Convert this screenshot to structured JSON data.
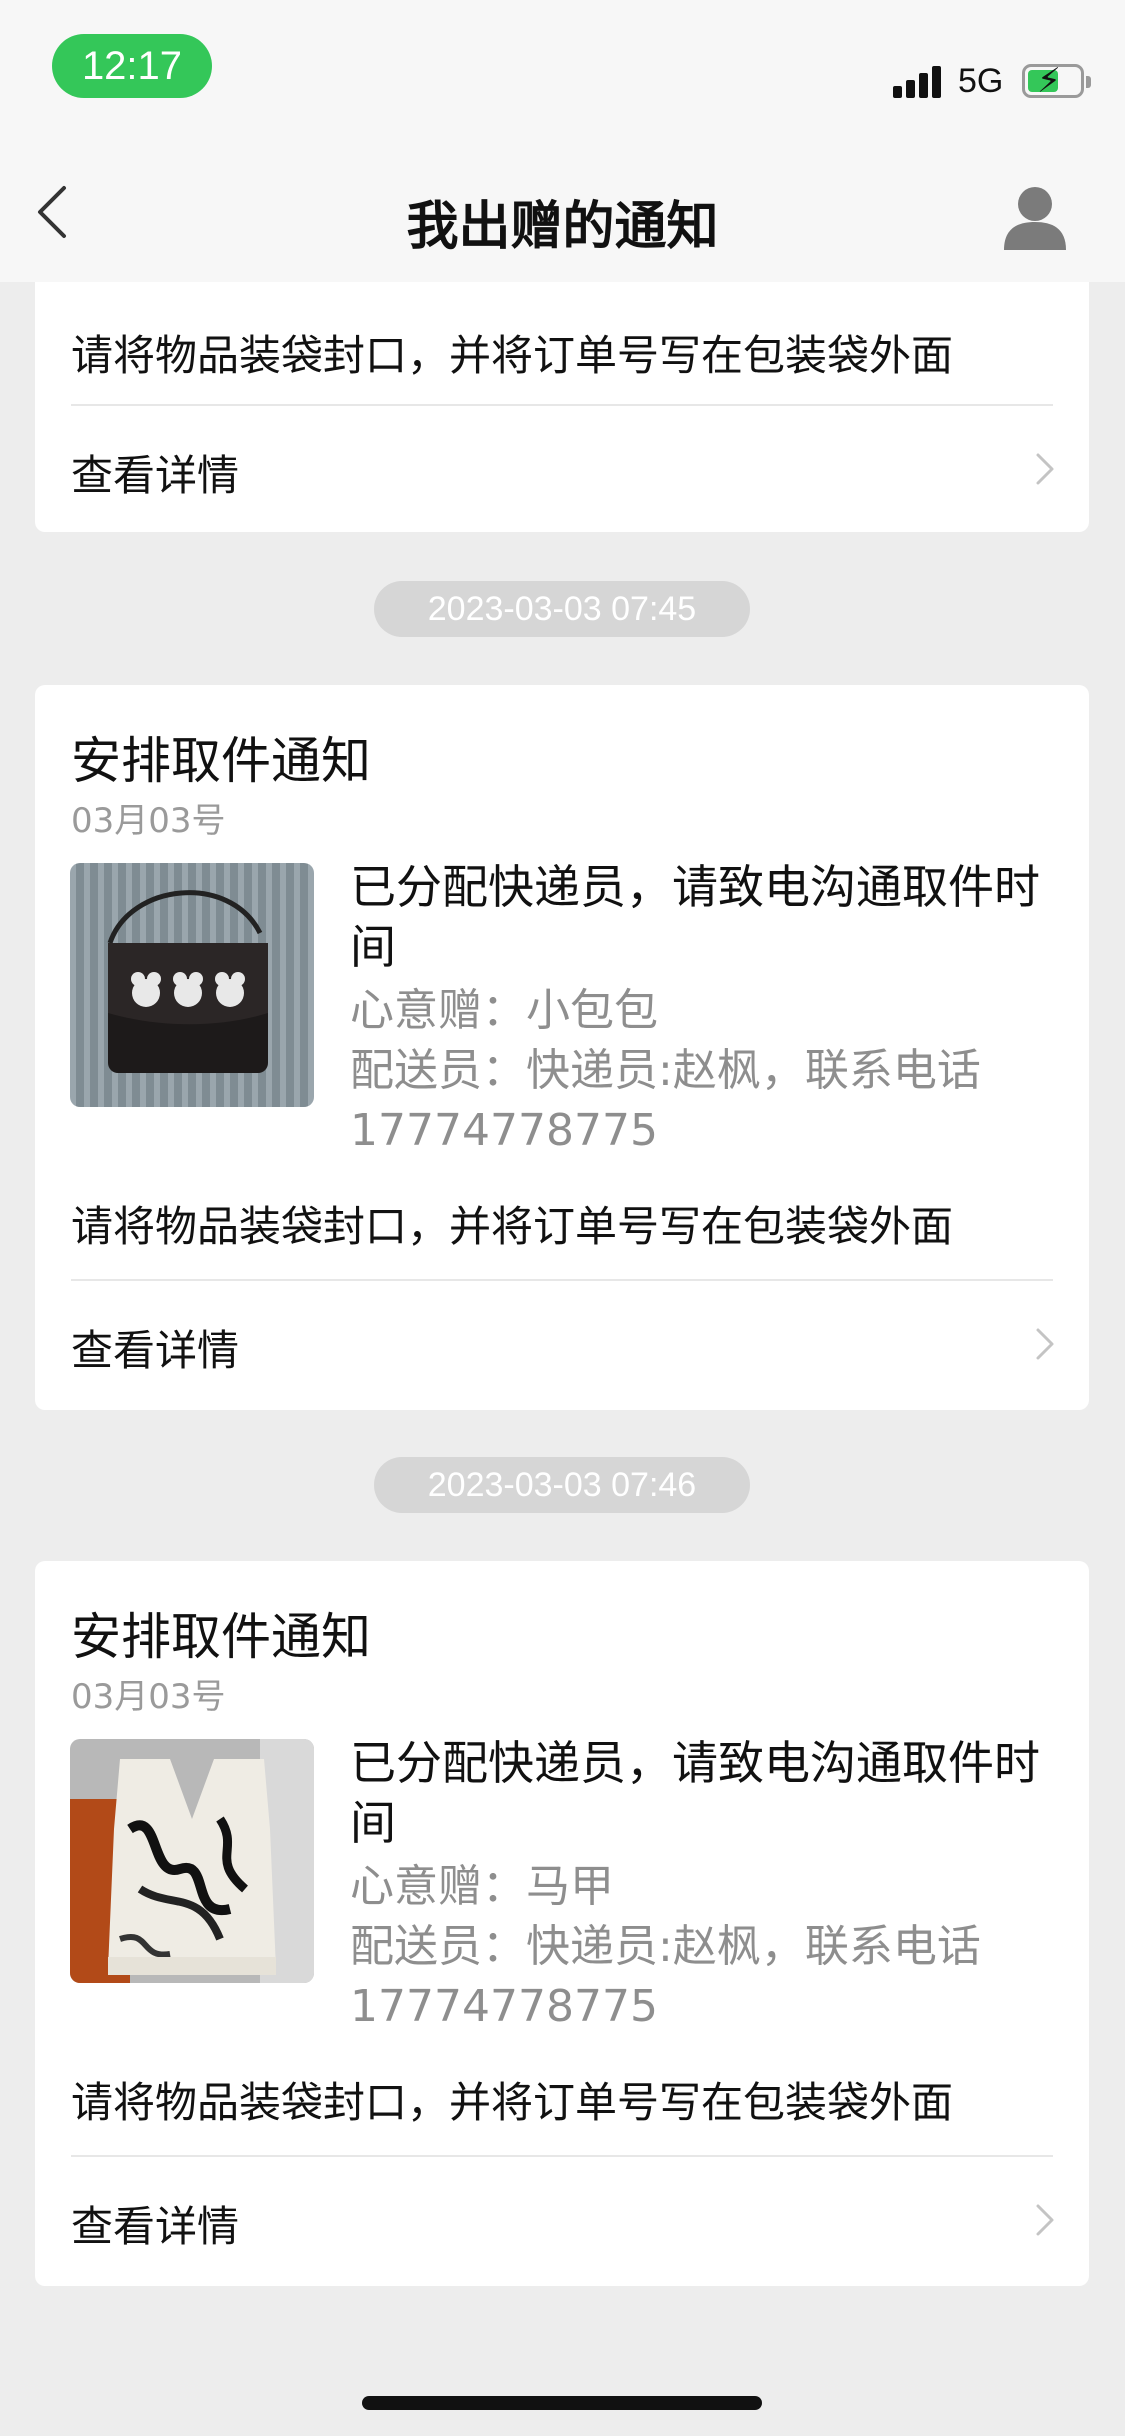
{
  "status_bar": {
    "time": "12:17",
    "network": "5G",
    "colors": {
      "time_pill": "#34c759",
      "battery_fill": "#34c759"
    }
  },
  "nav": {
    "title": "我出赠的通知",
    "back_icon": "chevron-left-icon",
    "profile_icon": "person-icon"
  },
  "notifications": [
    {
      "instruction": "请将物品装袋封口，并将订单号写在包装袋外面",
      "detail_label": "查看详情"
    },
    {
      "timestamp": "2023-03-03 07:45",
      "title": "安排取件通知",
      "date": "03月03号",
      "message": "已分配快递员，请致电沟通取件时间",
      "gift_line": "心意赠：小包包",
      "courier_line": "配送员：快递员:赵枫，联系电话17774778775",
      "instruction": "请将物品装袋封口，并将订单号写在包装袋外面",
      "detail_label": "查看详情",
      "thumb_icon": "handbag-photo"
    },
    {
      "timestamp": "2023-03-03 07:46",
      "title": "安排取件通知",
      "date": "03月03号",
      "message": "已分配快递员，请致电沟通取件时间",
      "gift_line": "心意赠：马甲",
      "courier_line": "配送员：快递员:赵枫，联系电话17774778775",
      "instruction": "请将物品装袋封口，并将订单号写在包装袋外面",
      "detail_label": "查看详情",
      "thumb_icon": "vest-photo"
    }
  ]
}
